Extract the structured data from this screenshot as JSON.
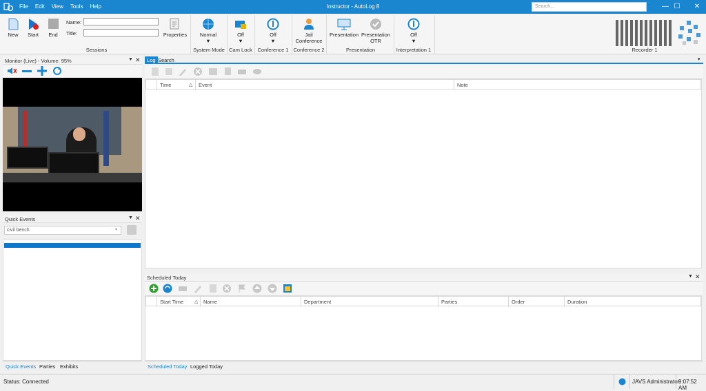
{
  "app": {
    "title": "Instructor - AutoLog 8",
    "search_placeholder": "Search..."
  },
  "menu": [
    "File",
    "Edit",
    "View",
    "Tools",
    "Help"
  ],
  "ribbon": {
    "new_label": "New",
    "start_label": "Start",
    "end_label": "End",
    "name_label": "Name:",
    "title_label": "Title:",
    "properties_label": "Properties",
    "sessions_group": "Sessions",
    "system_mode_value": "Normal",
    "system_mode_group": "System Mode",
    "cam_lock_value": "Off",
    "cam_lock_group": "Cam Lock",
    "conference1_value": "Off",
    "conference1_group": "Conference 1",
    "jail_conference_label": "Jail Conference",
    "conference2_group": "Conference 2",
    "presentation_label": "Presentation",
    "presentation_otr_label": "Presentation OTR",
    "presentation_group": "Presentation",
    "interpretation_value": "Off",
    "interpretation_group": "Interpretation 1",
    "recorder_label": "Recorder 1",
    "dropdown_arrow": "▼"
  },
  "monitor": {
    "title": "Monitor (Live) - Volume: 95%"
  },
  "quick_events": {
    "title": "Quick Events",
    "selected": "civil bench"
  },
  "left_tabs": [
    "Quick Events",
    "Parties",
    "Exhibits"
  ],
  "log": {
    "tabs": [
      "Log",
      "Search"
    ],
    "columns": [
      "Time",
      "Event",
      "Note"
    ]
  },
  "scheduled": {
    "title": "Scheduled Today",
    "columns": [
      "Start Time",
      "Name",
      "Department",
      "Parties",
      "Order",
      "Duration"
    ]
  },
  "bottom_tabs": [
    "Scheduled Today",
    "Logged Today"
  ],
  "status": {
    "text": "Status: Connected",
    "user": "JAVS Administrator",
    "time": "9:07:52 AM"
  },
  "colors": {
    "accent": "#1a86cf",
    "selection": "#0b78d0"
  }
}
